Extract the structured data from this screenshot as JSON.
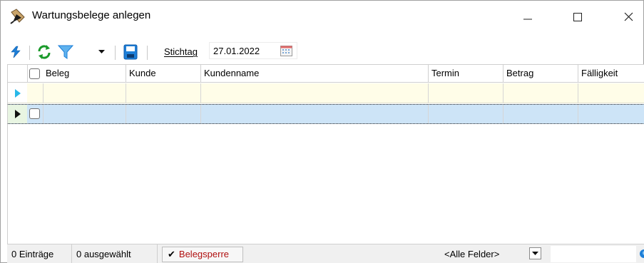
{
  "window": {
    "title": "Wartungsbelege anlegen",
    "icons": {
      "app": "pen-document-icon",
      "minimize": "minimize-icon",
      "maximize": "maximize-icon",
      "close": "close-icon"
    }
  },
  "toolbar": {
    "icons": [
      "lightning-icon",
      "refresh-icon",
      "filter-icon",
      "dropdown-arrow-icon",
      "save-icon",
      "calendar-icon"
    ],
    "stichtag_label": "Stichtag",
    "stichtag_value": "27.01.2022"
  },
  "grid": {
    "columns": [
      "Beleg",
      "Kunde",
      "Kundenname",
      "Termin",
      "Betrag",
      "Fälligkeit"
    ],
    "rows": []
  },
  "statusbar": {
    "entries": "0 Einträge",
    "selected": "0 ausgewählt",
    "belegsperre": "Belegsperre",
    "field_filter": "<Alle Felder>"
  },
  "colors": {
    "filter_row": "#fffde8",
    "selected_row": "#cde4f7",
    "belegsperre_text": "#b01010",
    "refresh_green": "#1a9a2a",
    "filter_blue": "#1e7fd8"
  }
}
